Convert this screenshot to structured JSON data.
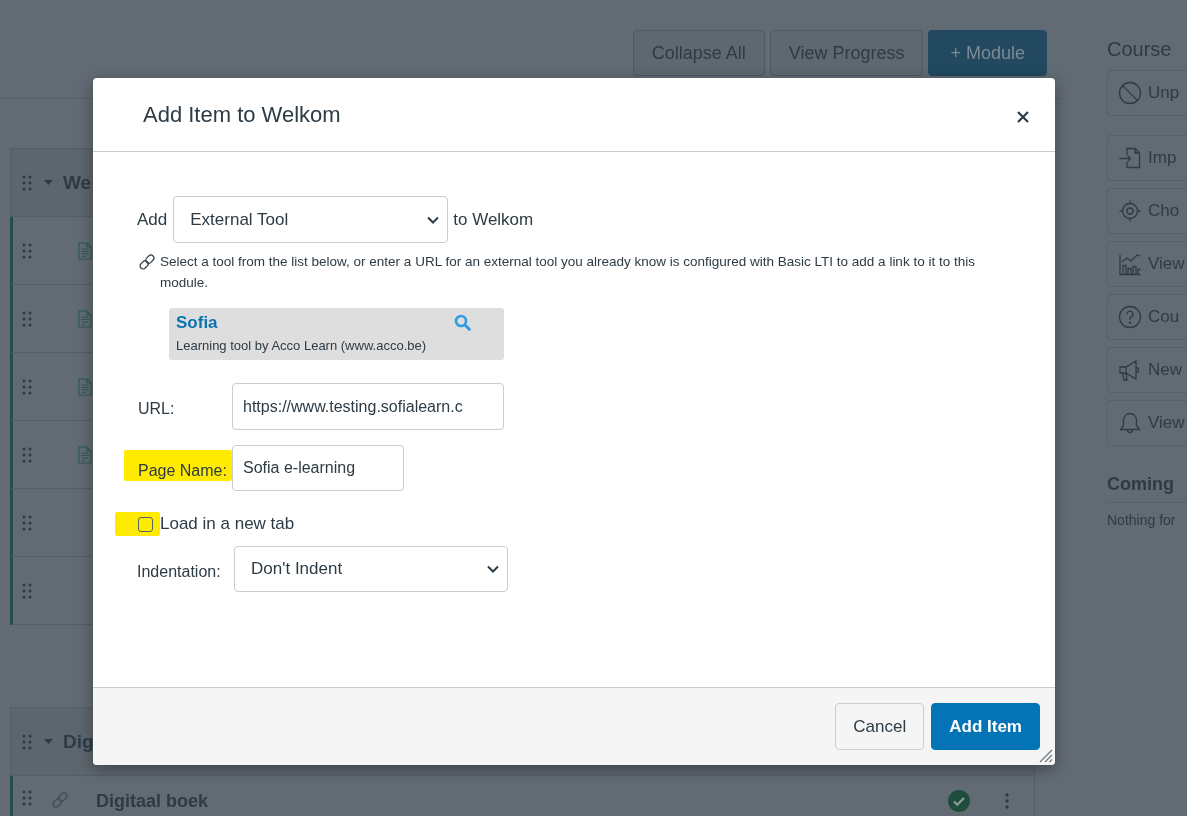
{
  "page": {
    "toolbar": [
      {
        "label": "Collapse All",
        "kind": "default"
      },
      {
        "label": "View Progress",
        "kind": "default"
      },
      {
        "label": "+ Module",
        "kind": "primary"
      }
    ],
    "modules": [
      {
        "title": "We",
        "expanded": true,
        "items": [
          {
            "kind": "page"
          },
          {
            "kind": "page"
          },
          {
            "kind": "page"
          },
          {
            "kind": "page"
          },
          {
            "kind": "plain"
          },
          {
            "kind": "plain"
          }
        ]
      },
      {
        "title": "Dig",
        "expanded": true,
        "items": [
          {
            "kind": "link",
            "title": "Digitaal boek",
            "published": true
          }
        ]
      }
    ]
  },
  "sidebar": {
    "title": "Course",
    "buttons": [
      {
        "label": "Unp",
        "kind": "ban"
      },
      {
        "label": "Imp",
        "kind": "import"
      },
      {
        "label": "Cho",
        "kind": "target"
      },
      {
        "label": "View",
        "kind": "chart"
      },
      {
        "label": "Cou",
        "kind": "question"
      },
      {
        "label": "New",
        "kind": "megaphone"
      },
      {
        "label": "View",
        "kind": "bell"
      }
    ],
    "coming_up": {
      "title": "Coming",
      "text": "Nothing for"
    }
  },
  "dialog": {
    "title": "Add Item to Welkom",
    "add_label": "Add",
    "type_select": {
      "value": "External Tool"
    },
    "target_text": "to Welkom",
    "help_text": "Select a tool from the list below, or enter a URL for an external tool you already know is configured with Basic LTI to add a link to it to this module.",
    "tools": [
      {
        "name": "Sofia",
        "description": "Learning tool by Acco Learn (www.acco.be)",
        "selected": true
      }
    ],
    "url": {
      "label": "URL:",
      "value": "https://www.testing.sofialearn.c"
    },
    "page_name": {
      "label": "Page Name:",
      "value": "Sofia e-learning",
      "highlighted": true
    },
    "new_tab": {
      "label": "Load in a new tab",
      "checked": false,
      "highlighted": true
    },
    "indentation": {
      "label": "Indentation:",
      "value": "Don't Indent"
    },
    "buttons": [
      {
        "label": "Cancel",
        "kind": "cancel"
      },
      {
        "label": "Add Item",
        "kind": "submit"
      }
    ]
  }
}
